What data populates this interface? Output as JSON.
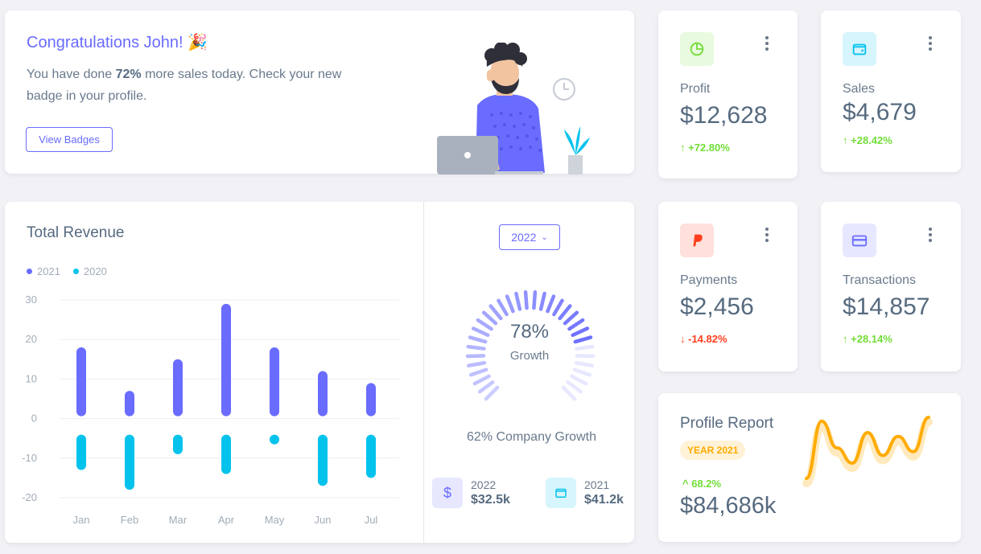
{
  "congrats": {
    "title": "Congratulations John! 🎉",
    "text_before": "You have done ",
    "text_bold": "72%",
    "text_after": " more sales today. Check your new badge in your profile.",
    "button_label": "View Badges"
  },
  "stats": {
    "profit": {
      "label": "Profit",
      "value": "$12,628",
      "change": "+72.80%",
      "direction": "up",
      "icon": "chart-icon",
      "color": "#71dd37"
    },
    "sales": {
      "label": "Sales",
      "value": "$4,679",
      "change": "+28.42%",
      "direction": "up",
      "icon": "wallet-icon",
      "color": "#03c3ec"
    },
    "payments": {
      "label": "Payments",
      "value": "$2,456",
      "change": "-14.82%",
      "direction": "down",
      "icon": "paypal-icon",
      "color": "#ff3e1d"
    },
    "transactions": {
      "label": "Transactions",
      "value": "$14,857",
      "change": "+28.14%",
      "direction": "up",
      "icon": "credit-card-icon",
      "color": "#696cff"
    }
  },
  "revenue": {
    "title": "Total Revenue",
    "year_select": "2022",
    "growth_percent": "78%",
    "growth_label": "Growth",
    "company_growth": "62% Company Growth",
    "mini_stats": [
      {
        "year": "2022",
        "value": "$32.5k",
        "icon": "dollar-icon"
      },
      {
        "year": "2021",
        "value": "$41.2k",
        "icon": "wallet-icon"
      }
    ]
  },
  "chart_data": {
    "type": "bar",
    "categories": [
      "Jan",
      "Feb",
      "Mar",
      "Apr",
      "May",
      "Jun",
      "Jul"
    ],
    "series": [
      {
        "name": "2021",
        "values": [
          18,
          7,
          15,
          29,
          18,
          12,
          9
        ],
        "color": "#696cff"
      },
      {
        "name": "2020",
        "values": [
          -13,
          -18,
          -9,
          -14,
          -5,
          -17,
          -15
        ],
        "color": "#03c3ec"
      }
    ],
    "ylim": [
      -20,
      30
    ],
    "yticks": [
      30,
      20,
      10,
      0,
      -10,
      -20
    ],
    "grid": true,
    "legend_position": "top-left"
  },
  "gauge_data": {
    "value": 78,
    "type": "radial-bar"
  },
  "report": {
    "title": "Profile Report",
    "badge": "YEAR 2021",
    "change": "68.2%",
    "value": "$84,686k",
    "spark_values": [
      0,
      75,
      40,
      20,
      60,
      30,
      55,
      35,
      80
    ]
  },
  "colors": {
    "primary": "#696cff",
    "info": "#03c3ec",
    "success": "#71dd37",
    "danger": "#ff3e1d",
    "warning": "#ffab00"
  }
}
